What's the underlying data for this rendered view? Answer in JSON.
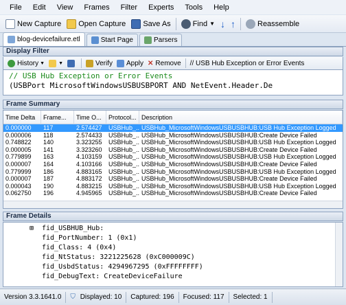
{
  "menu": [
    "File",
    "Edit",
    "View",
    "Frames",
    "Filter",
    "Experts",
    "Tools",
    "Help"
  ],
  "toolbar": {
    "new_capture": "New Capture",
    "open_capture": "Open Capture",
    "save_as": "Save As",
    "find": "Find",
    "reassemble": "Reassemble"
  },
  "tabs": [
    {
      "label": "blog-devicefailure.etl"
    },
    {
      "label": "Start Page"
    },
    {
      "label": "Parsers"
    }
  ],
  "display_filter": {
    "title": "Display Filter",
    "history": "History",
    "verify": "Verify",
    "apply": "Apply",
    "remove": "Remove",
    "current": "// USB Hub Exception or Error Events",
    "line1": "// USB Hub Exception or Error Events",
    "line2": "(USBPort MicrosoftWindowsUSBUSBPORT AND NetEvent.Header.De"
  },
  "frame_summary": {
    "title": "Frame Summary",
    "columns": [
      "Time Delta",
      "Frame...",
      "Time O...",
      "Protocol...",
      "Description"
    ],
    "rows": [
      [
        "0.000000",
        "117",
        "2.574427",
        "USBHub_...",
        "USBHub_MicrosoftWindowsUSBUSBHUB:USB Hub Exception Logged"
      ],
      [
        "0.000006",
        "118",
        "2.574433",
        "USBHub_...",
        "USBHub_MicrosoftWindowsUSBUSBHUB:Create Device Failed"
      ],
      [
        "0.748822",
        "140",
        "3.323255",
        "USBHub_...",
        "USBHub_MicrosoftWindowsUSBUSBHUB:USB Hub Exception Logged"
      ],
      [
        "0.000005",
        "141",
        "3.323260",
        "USBHub_...",
        "USBHub_MicrosoftWindowsUSBUSBHUB:Create Device Failed"
      ],
      [
        "0.779899",
        "163",
        "4.103159",
        "USBHub_...",
        "USBHub_MicrosoftWindowsUSBUSBHUB:USB Hub Exception Logged"
      ],
      [
        "0.000007",
        "164",
        "4.103166",
        "USBHub_...",
        "USBHub_MicrosoftWindowsUSBUSBHUB:Create Device Failed"
      ],
      [
        "0.779999",
        "186",
        "4.883165",
        "USBHub_...",
        "USBHub_MicrosoftWindowsUSBUSBHUB:USB Hub Exception Logged"
      ],
      [
        "0.000007",
        "187",
        "4.883172",
        "USBHub_...",
        "USBHub_MicrosoftWindowsUSBUSBHUB:Create Device Failed"
      ],
      [
        "0.000043",
        "190",
        "4.883215",
        "USBHub_...",
        "USBHub_MicrosoftWindowsUSBUSBHUB:USB Hub Exception Logged"
      ],
      [
        "0.062750",
        "196",
        "4.945965",
        "USBHub_...",
        "USBHub_MicrosoftWindowsUSBUSBHUB:Create Device Failed"
      ]
    ]
  },
  "frame_details": {
    "title": "Frame Details",
    "lines": [
      "fid_USBHUB_Hub:",
      "fid_PortNumber: 1 (0x1)",
      "fid_Class: 4 (0x4)",
      "fid_NtStatus: 3221225628 (0xC000009C)",
      "fid_UsbdStatus: 4294967295 (0xFFFFFFFF)",
      "fid_DebugText: CreateDeviceFailure"
    ]
  },
  "status": {
    "version": "Version 3.3.1641.0",
    "displayed": "Displayed: 10",
    "captured": "Captured: 196",
    "focused": "Focused: 117",
    "selected": "Selected: 1"
  },
  "colors": {
    "selection": "#3399ff",
    "comment": "#1a8a1a",
    "accent": "#8da2bf"
  }
}
